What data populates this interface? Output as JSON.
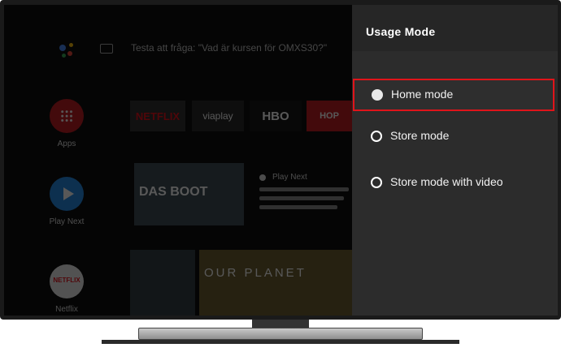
{
  "screen": {
    "search_hint": "Testa att fråga: \"Vad är kursen för OMXS30?\"",
    "sidebar": [
      {
        "label": "Apps",
        "icon": "apps-grid-icon"
      },
      {
        "label": "Play Next",
        "icon": "play-icon"
      },
      {
        "label": "Netflix",
        "icon": "netflix-icon"
      }
    ],
    "app_tiles": [
      "NETFLIX",
      "viaplay",
      "HBO",
      "HOP"
    ],
    "play_next": {
      "label": "Play Next",
      "poster_title": "DAS BOOT"
    },
    "row2_poster_title": "OUR PLANET"
  },
  "panel": {
    "title": "Usage Mode",
    "options": [
      {
        "label": "Home mode",
        "selected": true
      },
      {
        "label": "Store mode",
        "selected": false
      },
      {
        "label": "Store mode with video",
        "selected": false
      }
    ]
  },
  "colors": {
    "panel_bg": "#2c2c2c",
    "selection_border": "#e0141a",
    "netflix_red": "#e50914"
  }
}
